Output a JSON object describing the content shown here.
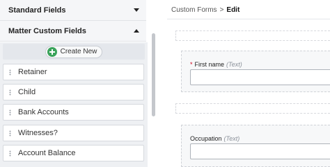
{
  "sidebar": {
    "standard_fields_label": "Standard Fields",
    "matter_custom_fields_label": "Matter Custom Fields",
    "create_new_label": "Create New",
    "items": [
      {
        "label": "Retainer"
      },
      {
        "label": "Child"
      },
      {
        "label": "Bank Accounts"
      },
      {
        "label": "Witnesses?"
      },
      {
        "label": "Account Balance"
      }
    ]
  },
  "breadcrumb": {
    "parent": "Custom Forms",
    "separator": ">",
    "current": "Edit"
  },
  "form": {
    "fields": [
      {
        "label": "First name",
        "type": "(Text)",
        "required_mark": "*",
        "value": ""
      },
      {
        "label": "Occupation",
        "type": "(Text)",
        "value": ""
      }
    ]
  },
  "colors": {
    "accent_green": "#3aa35b",
    "required_red": "#d0021b"
  }
}
